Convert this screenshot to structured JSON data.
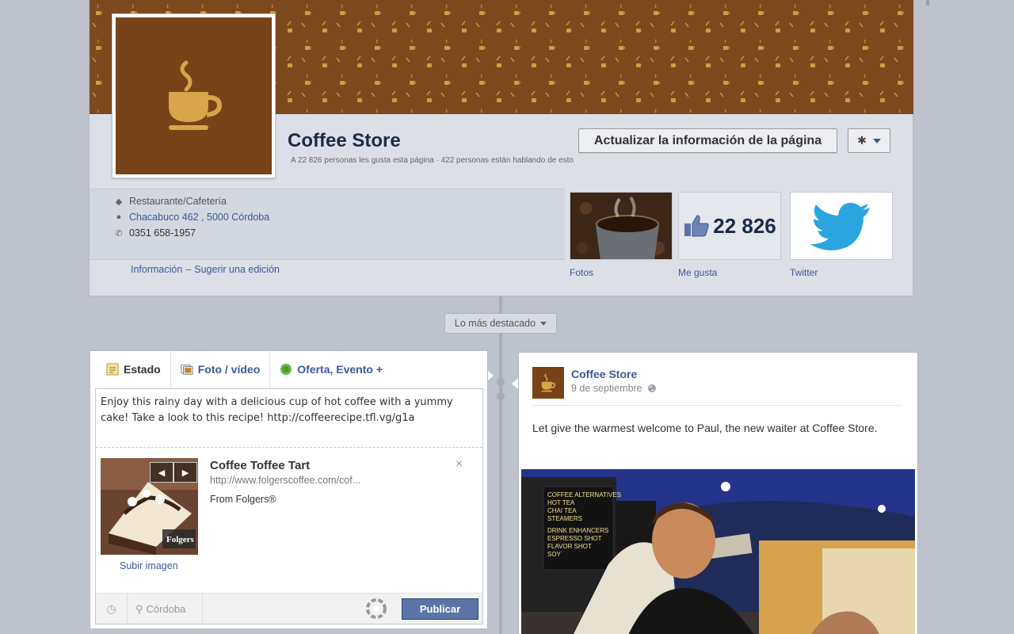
{
  "page": {
    "title": "Coffee Store",
    "stats": "A 22 826 personas les gusta esta página · 422 personas están hablando de esto",
    "update_button": "Actualizar la información de la página"
  },
  "info": {
    "category": "Restaurante/Cafetería",
    "address": "Chacabuco 462 , 5000 Córdoba",
    "phone": "0351 658-1957",
    "info_link": "Información",
    "separator": "–",
    "suggest_link": "Sugerir una edición"
  },
  "apps": {
    "photos_label": "Fotos",
    "likes_count": "22 826",
    "likes_label": "Me gusta",
    "twitter_label": "Twitter"
  },
  "timeline": {
    "highlights_label": "Lo más destacado"
  },
  "composer": {
    "tabs": [
      {
        "label": "Estado"
      },
      {
        "label": "Foto / vídeo"
      },
      {
        "label": "Oferta, Evento +"
      }
    ],
    "status_text": "Enjoy this rainy day with a delicious cup of hot coffee with a yummy cake! Take a look to this recipe! http://coffeerecipe.tfl.vg/g1a",
    "link_preview": {
      "title": "Coffee Toffee Tart",
      "url": "http://www.folgerscoffee.com/cof...",
      "description": "From Folgers®",
      "image_brand": "Folgers",
      "close_glyph": "×"
    },
    "upload_image_link": "Subir imagen",
    "location": "Córdoba",
    "publish_button": "Publicar"
  },
  "post": {
    "author": "Coffee Store",
    "date": "9 de septiembre",
    "text": "Let give the warmest welcome to Paul, the new waiter at Coffee Store.",
    "photo_sign": [
      "COFFEE ALTERNATIVES",
      "HOT TEA",
      "CHAI TEA",
      "STEAMERS",
      "DRINK ENHANCERS",
      "ESPRESSO SHOT",
      "FLAVOR SHOT",
      "SOY"
    ]
  },
  "colors": {
    "brand_brown": "#784318",
    "cover_brown": "#7d4a1e",
    "coffee_gold": "#d9a54a",
    "facebook_blue": "#3b5998",
    "publish_blue": "#5b74a8",
    "twitter_blue": "#2aa5e0"
  }
}
